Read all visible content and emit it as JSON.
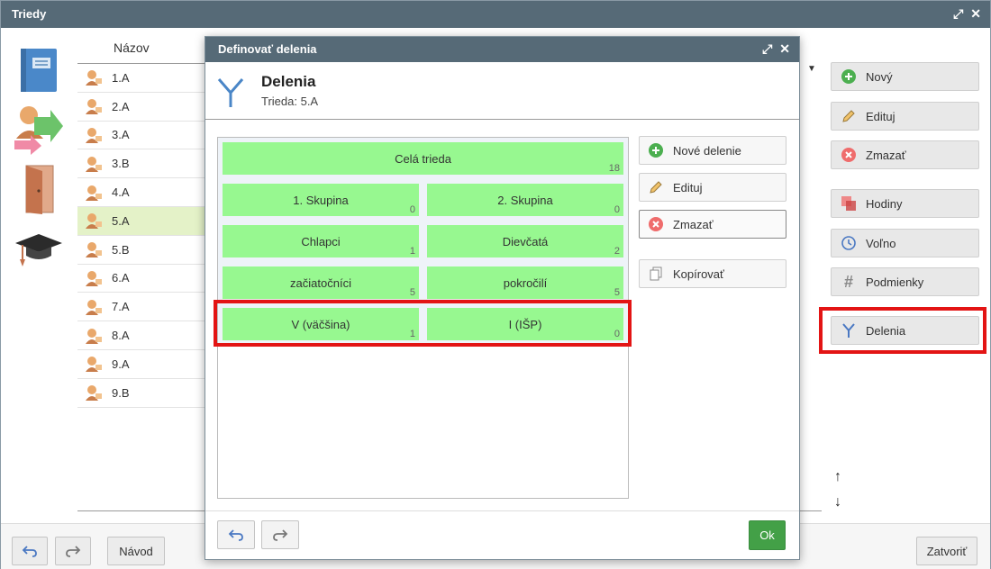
{
  "main": {
    "title": "Triedy",
    "column_header": "Názov",
    "classes": [
      "1.A",
      "2.A",
      "3.A",
      "3.B",
      "4.A",
      "5.A",
      "5.B",
      "6.A",
      "7.A",
      "8.A",
      "9.A",
      "9.B"
    ],
    "selected_class": "5.A",
    "buttons": {
      "new": "Nový",
      "edit": "Edituj",
      "delete": "Zmazať",
      "hours": "Hodiny",
      "free": "Voľno",
      "conditions": "Podmienky",
      "divisions": "Delenia"
    },
    "footer": {
      "guide": "Návod",
      "close": "Zatvoriť"
    }
  },
  "dialog": {
    "title": "Definovať delenia",
    "heading": "Delenia",
    "subheading": "Trieda: 5.A",
    "groups": {
      "whole": {
        "label": "Celá trieda",
        "count": "18"
      },
      "row1": [
        {
          "label": "1. Skupina",
          "count": "0"
        },
        {
          "label": "2. Skupina",
          "count": "0"
        }
      ],
      "row2": [
        {
          "label": "Chlapci",
          "count": "1"
        },
        {
          "label": "Dievčatá",
          "count": "2"
        }
      ],
      "row3": [
        {
          "label": "začiatočníci",
          "count": "5"
        },
        {
          "label": "pokročilí",
          "count": "5"
        }
      ],
      "row4": [
        {
          "label": "V (väčšina)",
          "count": "1"
        },
        {
          "label": "I (IŠP)",
          "count": "0"
        }
      ]
    },
    "buttons": {
      "new_division": "Nové delenie",
      "edit": "Edituj",
      "delete": "Zmazať",
      "copy": "Kopírovať",
      "ok": "Ok"
    }
  },
  "colors": {
    "titlebar": "#566a77",
    "group_green": "#97f890",
    "highlight_red": "#e31414",
    "ok_green": "#43a047",
    "selected_row": "#e4f2c8"
  }
}
